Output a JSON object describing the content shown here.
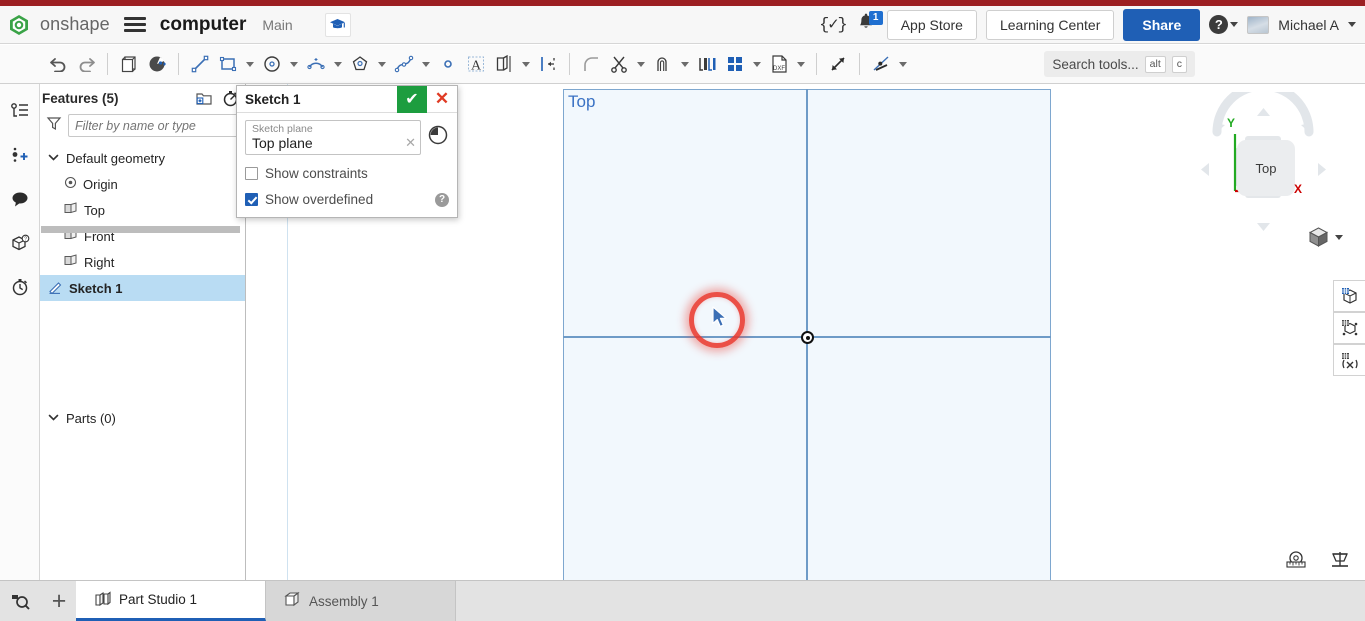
{
  "header": {
    "brand": "onshape",
    "logo_icon": "onshape-logo-icon",
    "menu_icon": "hamburger-menu-icon",
    "document_title": "computer",
    "branch": "Main",
    "learning_badge_icon": "graduation-cap-icon",
    "featurescript_icon": "featurescript-icon",
    "featurescript_glyph": "{✓}",
    "notifications_icon": "notification-bell-icon",
    "notifications_count": "1",
    "app_store_label": "App Store",
    "learning_center_label": "Learning Center",
    "share_label": "Share",
    "help_icon": "help-question-icon",
    "help_glyph": "?",
    "avatar_icon": "user-avatar",
    "user_name": "Michael A",
    "accent_blue": "#1f5fb5",
    "top_strip_color": "#9c1f22"
  },
  "toolbar": {
    "undo_icon": "undo-arrow-icon",
    "redo_icon": "redo-arrow-icon",
    "tools": [
      {
        "name": "copy-paste-icon",
        "caret": false
      },
      {
        "name": "sketch-mode-icon",
        "caret": false
      },
      {
        "name": "line-tool-icon",
        "caret": false
      },
      {
        "name": "rectangle-tool-icon",
        "caret": true
      },
      {
        "name": "circle-tool-icon",
        "caret": true
      },
      {
        "name": "arc-tool-icon",
        "caret": true
      },
      {
        "name": "polygon-tool-icon",
        "caret": true
      },
      {
        "name": "spline-tool-icon",
        "caret": true
      },
      {
        "name": "point-tool-icon",
        "caret": false
      },
      {
        "name": "text-tool-icon",
        "caret": false
      },
      {
        "name": "mirror-tool-icon",
        "caret": true
      },
      {
        "name": "dimension-tool-icon",
        "caret": false
      },
      {
        "name": "fillet-tool-icon",
        "caret": false
      },
      {
        "name": "trim-tool-icon",
        "caret": true
      },
      {
        "name": "offset-tool-icon",
        "caret": true
      },
      {
        "name": "use-projection-icon",
        "caret": false
      },
      {
        "name": "pattern-tool-icon",
        "caret": true
      },
      {
        "name": "import-dxf-icon",
        "caret": true
      },
      {
        "name": "extend-tool-icon",
        "caret": false
      },
      {
        "name": "constraint-tool-icon",
        "caret": true
      }
    ],
    "search_placeholder": "Search tools...",
    "search_icon": "search-tools-icon",
    "shortcut_alt": "alt",
    "shortcut_key": "c"
  },
  "left_rail": {
    "items": [
      {
        "name": "feature-list-icon"
      },
      {
        "name": "insert-feature-icon"
      },
      {
        "name": "comments-icon"
      },
      {
        "name": "parts-help-icon"
      },
      {
        "name": "history-icon"
      }
    ]
  },
  "feature_panel": {
    "title": "Features (5)",
    "new_folder_icon": "new-folder-icon",
    "timer_icon": "timer-icon",
    "filter_icon": "filter-funnel-icon",
    "filter_placeholder": "Filter by name or type",
    "tree": [
      {
        "label": "Default geometry",
        "icon": "chevron-down-icon",
        "level": 0,
        "selected": false
      },
      {
        "label": "Origin",
        "icon": "origin-icon",
        "level": 1,
        "selected": false
      },
      {
        "label": "Top",
        "icon": "plane-icon",
        "level": 1,
        "selected": false
      },
      {
        "label": "Front",
        "icon": "plane-icon",
        "level": 1,
        "selected": false
      },
      {
        "label": "Right",
        "icon": "plane-icon",
        "level": 1,
        "selected": false
      },
      {
        "label": "Sketch 1",
        "icon": "sketch-pencil-icon",
        "level": 0,
        "selected": true
      }
    ],
    "rollback_bar": "rollback-bar",
    "parts_label": "Parts (0)",
    "parts_chevron": "chevron-down-icon",
    "flyout_icon": "feature-list-flyout-icon",
    "selection_color": "#b9dcf3"
  },
  "sketch_dialog": {
    "title": "Sketch 1",
    "accept_icon": "accept-check-icon",
    "accept_glyph": "✔",
    "cancel_icon": "cancel-x-icon",
    "cancel_glyph": "✕",
    "plane_field_label": "Sketch plane",
    "plane_field_value": "Top plane",
    "clear_icon": "clear-field-icon",
    "clear_glyph": "✕",
    "history_icon": "sketch-history-clock-icon",
    "show_constraints_label": "Show constraints",
    "show_constraints_checked": false,
    "show_overdefined_label": "Show overdefined",
    "show_overdefined_checked": true,
    "help_icon": "dialog-help-icon",
    "help_glyph": "?",
    "accept_color": "#1d9d3f",
    "cancel_color": "#e03b24"
  },
  "graphics": {
    "plane_label": "Top",
    "plane_fill": "#f2f8fd",
    "plane_border": "#7ea7cf",
    "axis_color": "#6e9bc7",
    "origin_icon": "sketch-origin-point",
    "cursor_icon": "mouse-cursor",
    "click_highlight_icon": "click-highlight-ring",
    "click_highlight_color": "#e9382e",
    "viewcube": {
      "face_label": "Top",
      "axis_x_label": "X",
      "axis_y_label": "Y",
      "axis_x_color": "#cc0000",
      "axis_y_color": "#22aa22",
      "rotate_cw_icon": "rotate-clockwise-icon",
      "rotate_ccw_icon": "rotate-counterclockwise-icon",
      "arrow_up_icon": "view-arrow-up-icon",
      "arrow_down_icon": "view-arrow-down-icon",
      "arrow_left_icon": "view-arrow-left-icon",
      "arrow_right_icon": "view-arrow-right-icon",
      "view_cube_dropdown_icon": "view-orientation-cube-icon"
    },
    "right_rail": [
      {
        "name": "display-state-panel-icon"
      },
      {
        "name": "appearance-panel-icon"
      },
      {
        "name": "render-panel-icon"
      }
    ],
    "bottom_icons": [
      {
        "name": "measure-tool-icon"
      },
      {
        "name": "mass-properties-icon"
      }
    ]
  },
  "tabbar": {
    "search_icon": "tab-search-icon",
    "add_icon": "add-tab-icon",
    "add_glyph": "+",
    "tabs": [
      {
        "label": "Part Studio 1",
        "icon": "part-studio-icon",
        "active": true
      },
      {
        "label": "Assembly 1",
        "icon": "assembly-icon",
        "active": false
      }
    ]
  }
}
